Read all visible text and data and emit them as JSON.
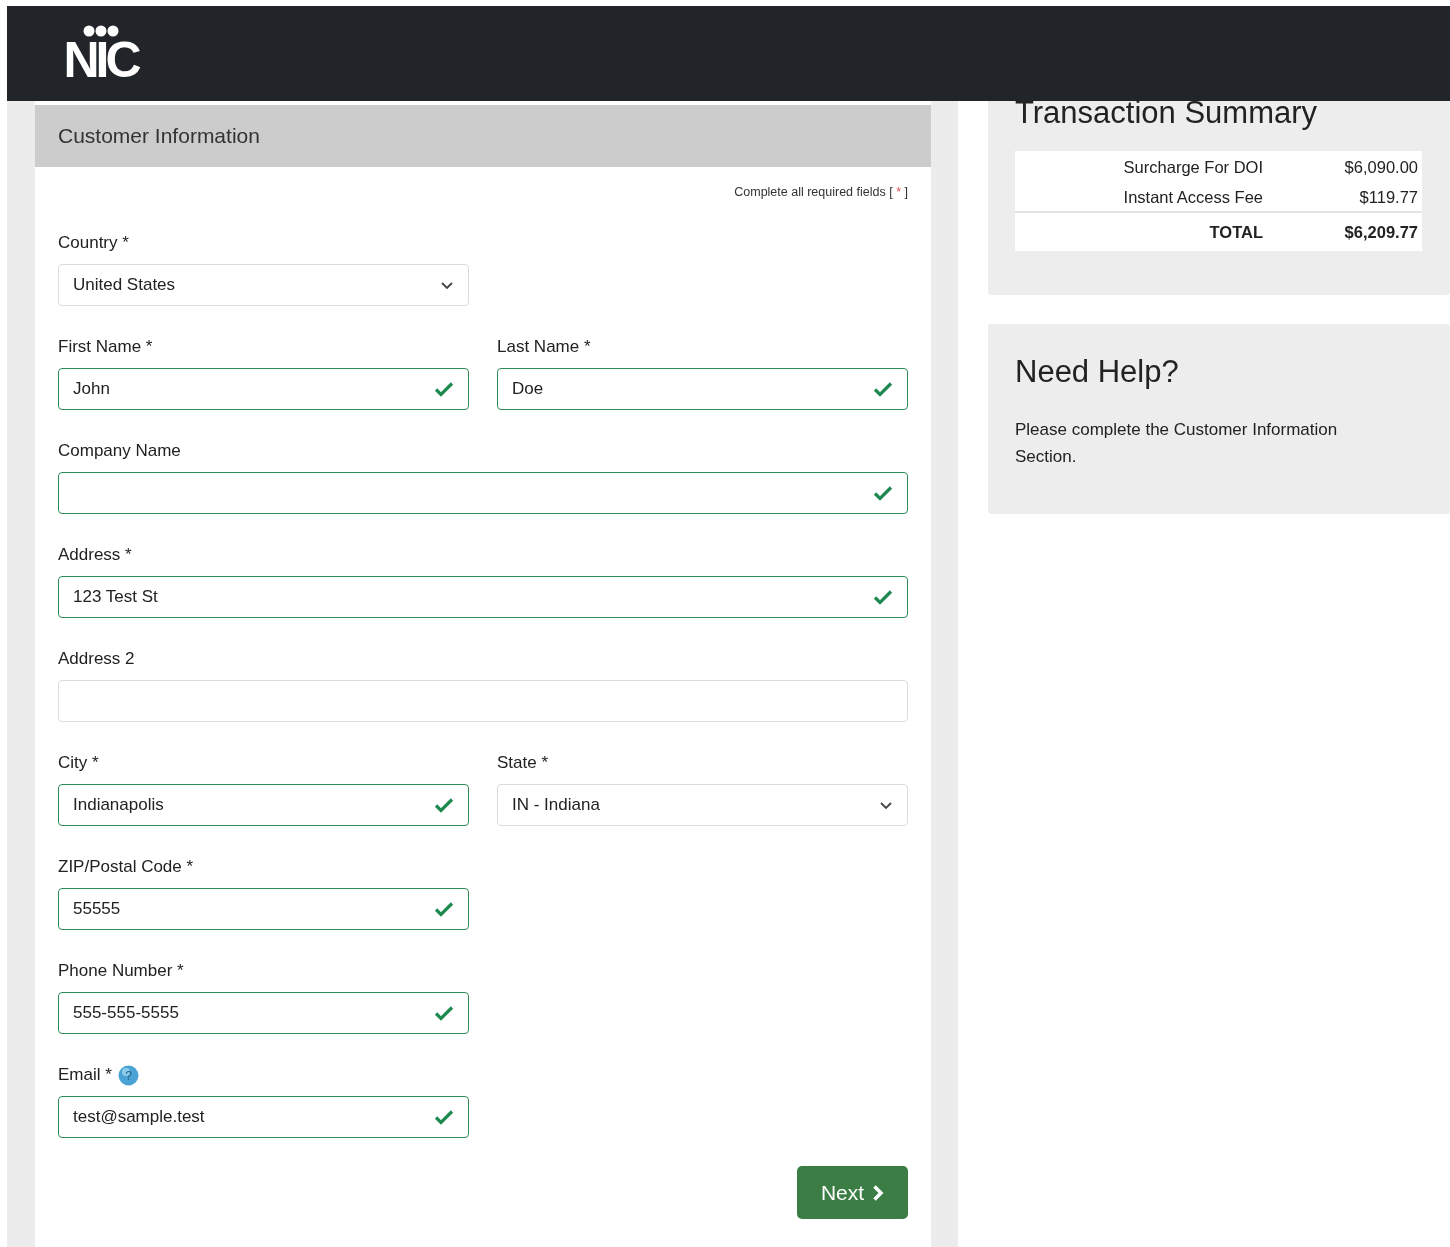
{
  "header": {
    "logo": "NIC"
  },
  "form": {
    "title": "Customer Information",
    "note": "Complete all required fields [",
    "note_star": "*",
    "note_end": "]",
    "rows": [
      [
        {
          "label": "Country *",
          "kind": "select",
          "value": "United States",
          "valid": false,
          "wide": false
        }
      ],
      [
        {
          "label": "First Name *",
          "kind": "input",
          "value": "John",
          "valid": true,
          "wide": false
        },
        {
          "label": "Last Name *",
          "kind": "input",
          "value": "Doe",
          "valid": true,
          "wide": false
        }
      ],
      [
        {
          "label": "Company Name",
          "kind": "input",
          "valid": true,
          "wide": true
        }
      ],
      [
        {
          "label": "Address *",
          "kind": "input",
          "value": "123 Test St",
          "valid": true,
          "wide": true
        }
      ],
      [
        {
          "label": "Address 2",
          "kind": "input",
          "valid": false,
          "wide": true
        }
      ],
      [
        {
          "label": "City *",
          "kind": "input",
          "value": "Indianapolis",
          "valid": true,
          "wide": false
        },
        {
          "label": "State *",
          "kind": "select",
          "value": "IN - Indiana",
          "valid": false,
          "wide": false
        }
      ],
      [
        {
          "label": "ZIP/Postal Code *",
          "kind": "input",
          "value": "55555",
          "valid": true,
          "wide": false
        }
      ],
      [
        {
          "label": "Phone Number *",
          "kind": "input",
          "value": "555-555-5555",
          "valid": true,
          "wide": false
        }
      ],
      [
        {
          "label": "Email *",
          "kind": "input",
          "value": "test@sample.test",
          "valid": true,
          "wide": false,
          "help": "?"
        }
      ]
    ],
    "next_button": "Next"
  },
  "summary": {
    "title": "Transaction Summary",
    "lines": [
      {
        "label": "Surcharge For DOI",
        "amount": "$6,090.00",
        "kind": "item"
      },
      {
        "label": "Instant Access Fee",
        "amount": "$119.77",
        "kind": "item"
      },
      {
        "label": "TOTAL",
        "amount": "$6,209.77",
        "kind": "total"
      }
    ]
  },
  "help": {
    "title": "Need Help?",
    "text": "Please complete the Customer Information Section."
  }
}
